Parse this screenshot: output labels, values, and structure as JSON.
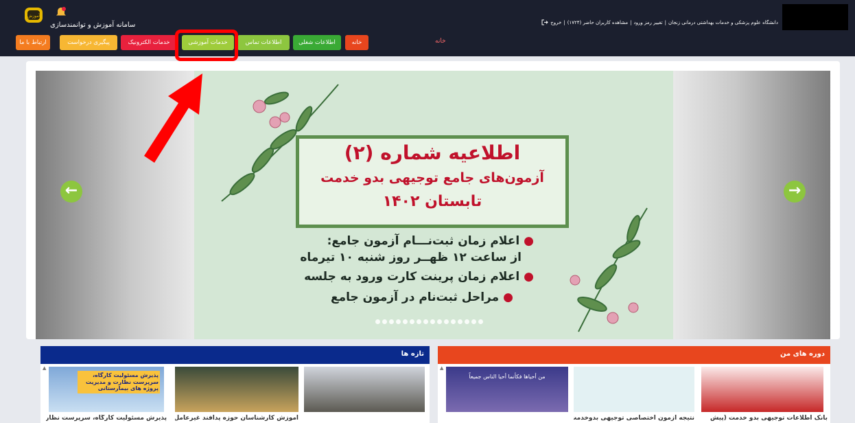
{
  "header": {
    "system_title": "سامانه آموزش و توانمندسازی",
    "logo_text": "آموزش",
    "university_text": "دانشگاه علوم پزشکی و خدمات بهداشتی درمانی زنجان",
    "change_password": "تغییر رمز ورود",
    "online_users": "مشاهده کاربران حاضر (۱۷۲۴)",
    "logout": "خروج"
  },
  "nav": {
    "home": "خانه",
    "job_info": "اطلاعات شغلی",
    "contact_info": "اطلاعات تماس",
    "education_services": "خدمات آموزشی",
    "electronic_services": "خدمات الکترونیک",
    "request_tracking": "پیگیری درخواست",
    "contact_us": "ارتباط با ما"
  },
  "breadcrumb": {
    "current": "خانه"
  },
  "slider": {
    "title": "اطلاعیه شماره (۲)",
    "subtitle": "آزمون‌های جامع توجیهی بدو خدمت",
    "season": "تابستان ۱۴۰۲",
    "bullet1_line1": "اعلام زمان ثبت‌نـــام آزمون جامع:",
    "bullet1_line2": "از ساعت ۱۲ ظهــر روز شنبه ۱۰ تیرماه",
    "bullet2": "اعلام زمان پرینت کارت ورود به جلسه",
    "bullet3": "مراحل ثبت‌نام در آزمون جامع",
    "prev_icon": "arrow-left-circle-icon",
    "next_icon": "arrow-right-circle-icon",
    "dot_count": 16
  },
  "my_courses": {
    "heading": "دوره های من",
    "card1": "بانک اطلاعات توجیهی بدو خدمت (پیش",
    "card2": "نتیجه آزمون اختصاصی توجیهی بدوخدمت",
    "card3_image_text": "من أحیاها فکأنما أحیا الناس جمیعاً"
  },
  "news": {
    "heading": "تازه ها",
    "card1": "پذیرش مسئولیت کارگاه، سرپرست نظارت و",
    "card1_image_text": "پذیرش مسئولیت کارگاه، سرپرست نظارت و مدیریت پروژه های بیمارستانی",
    "card2": "آموزش کارشناسان حوزه پدافند غیرعامل با"
  },
  "colors": {
    "topbar": "#1b1f2e",
    "home": "#e8461e",
    "job_info": "#3aaa35",
    "contact_info": "#8dc63f",
    "education_services": "#9fcc3b",
    "electronic_services": "#e8213d",
    "request_tracking": "#f7b733",
    "contact_us": "#f47c20",
    "my_courses_head": "#e8461e",
    "news_head": "#0a2a8c"
  }
}
